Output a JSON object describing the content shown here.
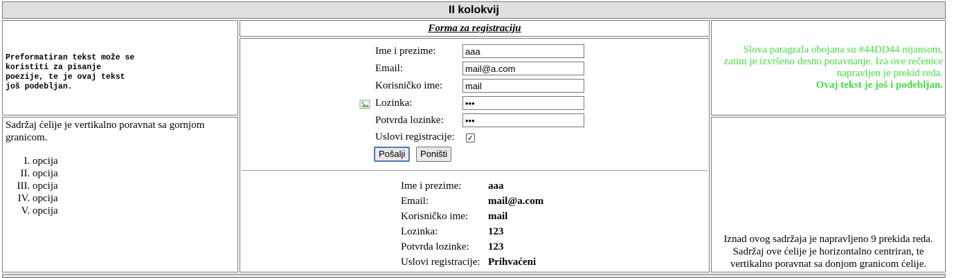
{
  "header": {
    "title": "II kolokvij"
  },
  "pre_cell": {
    "text": "Preformatiran tekst može se\nkoristiti za pisanje\npoezije, te je ovaj tekst\njoš podebljan."
  },
  "list_cell": {
    "paragraph": "Sadržaj ćelije je vertikalno poravnat sa gornjom granicom.",
    "items": [
      "opcija",
      "opcija",
      "opcija",
      "opcija",
      "opcija"
    ]
  },
  "form": {
    "title": "Forma za registraciju",
    "fields": {
      "name": {
        "label": "Ime i prezime:",
        "value": "aaa"
      },
      "email": {
        "label": "Email:",
        "value": "mail@a.com"
      },
      "username": {
        "label": "Korisničko ime:",
        "value": "mail"
      },
      "password": {
        "label": "Lozinka:",
        "value": "123"
      },
      "password_confirm": {
        "label": "Potvrda lozinke:",
        "value": "123"
      },
      "terms": {
        "label": "Uslovi registracije:",
        "checked": true
      }
    },
    "submit_label": "Pošalji",
    "reset_label": "Poništi"
  },
  "result": {
    "rows": [
      {
        "label": "Ime i prezime:",
        "value": "aaa"
      },
      {
        "label": "Email:",
        "value": "mail@a.com"
      },
      {
        "label": "Korisničko ime:",
        "value": "mail"
      },
      {
        "label": "Lozinka:",
        "value": "123"
      },
      {
        "label": "Potvrda lozinke:",
        "value": "123"
      },
      {
        "label": "Uslovi registracije:",
        "value": "Prihvaćeni"
      }
    ]
  },
  "green_cell": {
    "text": "Slova paragrafa obojana su #44DD44 nijansom, zatim je izvršeno desno poravnanje. Iza ove rečenice napravljen je prekid reda.",
    "bold_text": "Ovaj tekst je još i podebljan.",
    "color": "#44DD44"
  },
  "bottom_cell": {
    "text": "Iznad ovog sadržaja je napravljeno 9 prekida reda. Sadržaj ove ćelije je horizontalno centriran, te vertikalno poravnat sa donjom granicom ćelije."
  }
}
